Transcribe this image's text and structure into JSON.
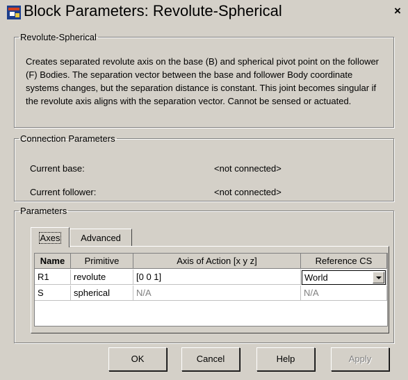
{
  "window": {
    "title": "Block Parameters: Revolute-Spherical",
    "close_glyph": "×",
    "icon": "simulink-block-icon"
  },
  "block": {
    "legend": "Revolute-Spherical",
    "description": "Creates separated revolute axis on the base (B) and spherical pivot point on the follower (F) Bodies. The separation vector between the base and follower Body coordinate systems changes, but the separation distance is constant. This joint becomes singular if the revolute axis aligns with the separation vector. Cannot be sensed or actuated."
  },
  "connection": {
    "legend": "Connection Parameters",
    "base_label": "Current base:",
    "base_value": "<not connected>",
    "follower_label": "Current follower:",
    "follower_value": "<not connected>"
  },
  "parameters": {
    "legend": "Parameters",
    "tabs": [
      {
        "label": "Axes",
        "active": true
      },
      {
        "label": "Advanced",
        "active": false
      }
    ],
    "table": {
      "headers": [
        "Name",
        "Primitive",
        "Axis of Action [x y z]",
        "Reference CS"
      ],
      "rows": [
        {
          "name": "R1",
          "primitive": "revolute",
          "axis": "[0 0 1]",
          "reference": "World"
        },
        {
          "name": "S",
          "primitive": "spherical",
          "axis": "N/A",
          "reference": "N/A"
        }
      ]
    }
  },
  "buttons": {
    "ok": "OK",
    "cancel": "Cancel",
    "help": "Help",
    "apply": "Apply"
  }
}
